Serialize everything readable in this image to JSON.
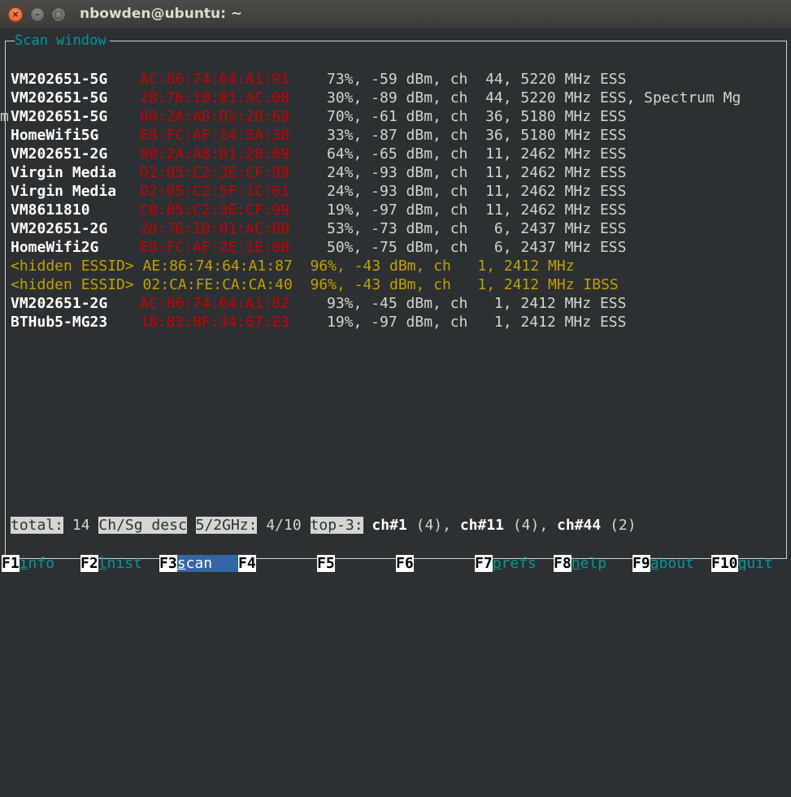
{
  "window": {
    "title": "nbowden@ubuntu: ~",
    "close_glyph": "×",
    "min_glyph": "–",
    "max_glyph": "□"
  },
  "scan_window": {
    "title": "Scan window",
    "rows": [
      {
        "prefix": "",
        "essid": "VM202651-5G",
        "mac": "AC:86:74:64:A1:91",
        "info": "73%, -59 dBm, ch  44, 5220 MHz ESS"
      },
      {
        "prefix": "",
        "essid": "VM202651-5G",
        "mac": "28:76:10:01:AC:08",
        "info": "30%, -89 dBm, ch  44, 5220 MHz ESS, Spectrum Mg"
      },
      {
        "prefix": "m",
        "essid": "VM202651-5G",
        "mac": "80:2A:A8:D2:20:69",
        "info": "70%, -61 dBm, ch  36, 5180 MHz ESS"
      },
      {
        "prefix": "",
        "essid": "HomeWifi5G",
        "mac": "E8:FC:AF:14:5A:38",
        "info": "33%, -87 dBm, ch  36, 5180 MHz ESS"
      },
      {
        "prefix": "",
        "essid": "VM202651-2G",
        "mac": "80:2A:A8:D1:20:69",
        "info": "64%, -65 dBm, ch  11, 2462 MHz ESS"
      },
      {
        "prefix": "",
        "essid": "Virgin Media",
        "mac": "D2:05:C2:3E:CF:99",
        "info": "24%, -93 dBm, ch  11, 2462 MHz ESS"
      },
      {
        "prefix": "",
        "essid": "Virgin Media",
        "mac": "D2:05:C2:5F:1C:61",
        "info": "24%, -93 dBm, ch  11, 2462 MHz ESS"
      },
      {
        "prefix": "",
        "essid": "VM8611810",
        "mac": "C0:05:C2:3E:CF:99",
        "info": "19%, -97 dBm, ch  11, 2462 MHz ESS"
      },
      {
        "prefix": "",
        "essid": "VM202651-2G",
        "mac": "28:76:10:01:AC:00",
        "info": "53%, -73 dBm, ch   6, 2437 MHz ESS"
      },
      {
        "prefix": "",
        "essid": "HomeWifi2G",
        "mac": "E8:FC:AF:2E:1E:88",
        "info": "50%, -75 dBm, ch   6, 2437 MHz ESS"
      }
    ],
    "hidden_rows": [
      {
        "text": "<hidden ESSID> AE:86:74:64:A1:87  96%, -43 dBm, ch   1, 2412 MHz"
      },
      {
        "text": "<hidden ESSID> 02:CA:FE:CA:CA:40  96%, -43 dBm, ch   1, 2412 MHz IBSS"
      }
    ],
    "tail_rows": [
      {
        "prefix": "",
        "essid": "VM202651-2G",
        "mac": "AC:86:74:64:A1:82",
        "info": "93%, -45 dBm, ch   1, 2412 MHz ESS"
      },
      {
        "prefix": "",
        "essid": "BTHub5-MG23",
        "mac": "18:83:BF:34:67:E3",
        "info": "19%, -97 dBm, ch   1, 2412 MHz ESS"
      }
    ]
  },
  "status_bar": {
    "total_label": "total:",
    "total_value": "14",
    "sort_label": "Ch/Sg desc",
    "band_label": "5/2GHz:",
    "band_value": "4/10",
    "top_label": "top-3:",
    "top1_ch": "ch#1",
    "top1_count": "(4),",
    "top2_ch": "ch#11",
    "top2_count": "(4),",
    "top3_ch": "ch#44",
    "top3_count": "(2)"
  },
  "function_keys": [
    {
      "num": "F1",
      "accel": "i",
      "rest": "nfo"
    },
    {
      "num": "F2",
      "accel": "l",
      "rest": "hist"
    },
    {
      "num": "F3",
      "accel": "s",
      "rest": "can"
    },
    {
      "num": "F4",
      "accel": "",
      "rest": ""
    },
    {
      "num": "F5",
      "accel": "",
      "rest": ""
    },
    {
      "num": "F6",
      "accel": "",
      "rest": ""
    },
    {
      "num": "F7",
      "accel": "p",
      "rest": "refs"
    },
    {
      "num": "F8",
      "accel": "h",
      "rest": "elp"
    },
    {
      "num": "F9",
      "accel": "a",
      "rest": "bout"
    },
    {
      "num": "F10",
      "accel": "q",
      "rest": "uit"
    }
  ]
}
